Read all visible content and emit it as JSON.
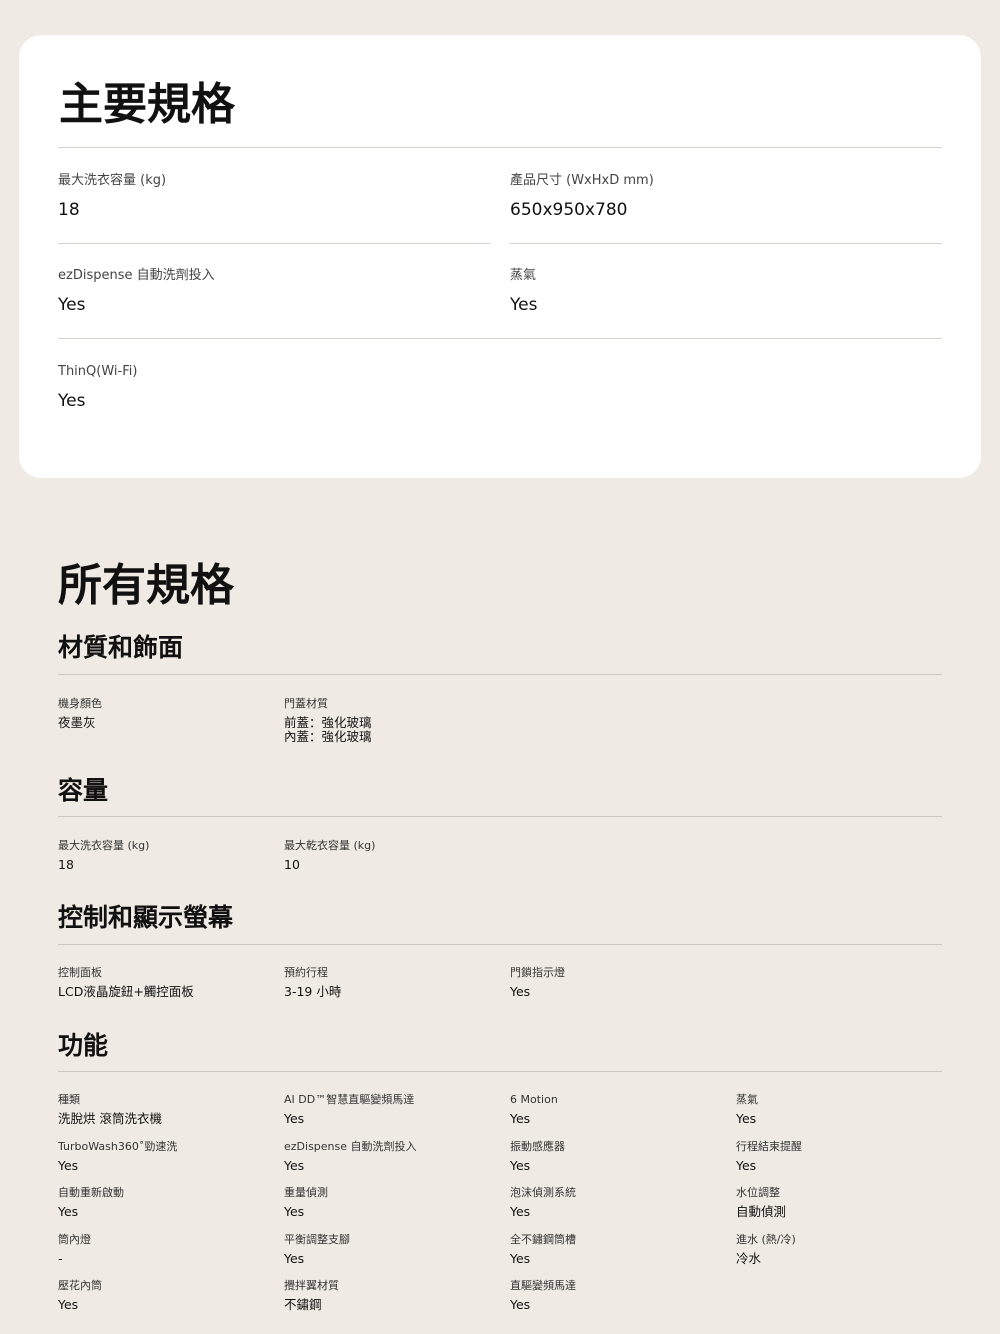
{
  "key_specs": {
    "title": "主要規格",
    "items": [
      {
        "label": "最大洗衣容量 (kg)",
        "value": "18"
      },
      {
        "label": "產品尺寸 (WxHxD mm)",
        "value": "650x950x780"
      },
      {
        "label": "ezDispense 自動洗劑投入",
        "value": "Yes"
      },
      {
        "label": "蒸氣",
        "value": "Yes"
      },
      {
        "label": "ThinQ(Wi-Fi)",
        "value": "Yes"
      }
    ]
  },
  "all_specs": {
    "title": "所有規格",
    "sections": [
      {
        "title": "材質和飾面",
        "items": [
          {
            "label": "機身顏色",
            "value": "夜墨灰"
          },
          {
            "label": "門蓋材質",
            "value": "前蓋：強化玻璃\n內蓋：強化玻璃"
          }
        ]
      },
      {
        "title": "容量",
        "items": [
          {
            "label": "最大洗衣容量 (kg)",
            "value": "18"
          },
          {
            "label": "最大乾衣容量 (kg)",
            "value": "10"
          }
        ]
      },
      {
        "title": "控制和顯示螢幕",
        "items": [
          {
            "label": "控制面板",
            "value": "LCD液晶旋鈕+觸控面板"
          },
          {
            "label": "預約行程",
            "value": "3-19 小時"
          },
          {
            "label": "門鎖指示燈",
            "value": "Yes"
          }
        ]
      },
      {
        "title": "功能",
        "items": [
          {
            "label": "種類",
            "value": "洗脫烘 滾筒洗衣機"
          },
          {
            "label": "AI DD™智慧直驅變頻馬達",
            "value": "Yes"
          },
          {
            "label": "6 Motion",
            "value": "Yes"
          },
          {
            "label": "蒸氣",
            "value": "Yes"
          },
          {
            "label": "TurboWash360˚勁速洗",
            "value": "Yes"
          },
          {
            "label": "ezDispense 自動洗劑投入",
            "value": "Yes"
          },
          {
            "label": "振動感應器",
            "value": "Yes"
          },
          {
            "label": "行程結束提醒",
            "value": "Yes"
          },
          {
            "label": "自動重新啟動",
            "value": "Yes"
          },
          {
            "label": "重量偵測",
            "value": "Yes"
          },
          {
            "label": "泡沫偵測系統",
            "value": "Yes"
          },
          {
            "label": "水位調整",
            "value": "自動偵測"
          },
          {
            "label": "筒內燈",
            "value": "-"
          },
          {
            "label": "平衡調整支腳",
            "value": "Yes"
          },
          {
            "label": "全不鏽鋼筒槽",
            "value": "Yes"
          },
          {
            "label": "進水 (熱/冷)",
            "value": "冷水"
          },
          {
            "label": "壓花內筒",
            "value": "Yes"
          },
          {
            "label": "攪拌翼材質",
            "value": "不鏽鋼"
          },
          {
            "label": "直驅變頻馬達",
            "value": "Yes"
          }
        ]
      }
    ]
  }
}
